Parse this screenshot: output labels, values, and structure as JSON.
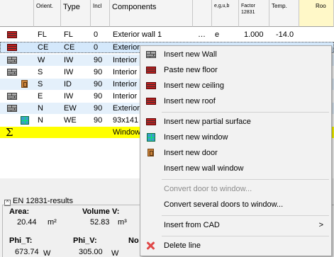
{
  "grid": {
    "headers": {
      "orient": "Orient.",
      "type": "Type",
      "incl": "Incl",
      "components": "Components",
      "egub": "e,g,u,b",
      "factor": "Factor\n12831",
      "temp": "Temp.",
      "room": "Roo"
    },
    "rows": [
      {
        "icon": "floor-icon",
        "orient": "FL",
        "type": "FL",
        "incl": "0",
        "component": "Exterior wall 1",
        "dots": "…",
        "egub": "e",
        "factor": "1.000",
        "temp": "-14.0"
      },
      {
        "icon": "floor-icon",
        "orient": "CE",
        "type": "CE",
        "incl": "0",
        "component": "Exterior"
      },
      {
        "icon": "wall-icon",
        "orient": "W",
        "type": "IW",
        "incl": "90",
        "component": "Interior"
      },
      {
        "icon": "wall-icon",
        "orient": "S",
        "type": "IW",
        "incl": "90",
        "component": "Interior"
      },
      {
        "icon": "door-icon",
        "orient": "S",
        "type": "ID",
        "incl": "90",
        "component": "Interior"
      },
      {
        "icon": "wall-icon",
        "orient": "E",
        "type": "IW",
        "incl": "90",
        "component": "Interior"
      },
      {
        "icon": "wall-icon",
        "orient": "N",
        "type": "EW",
        "incl": "90",
        "component": "Exterior"
      },
      {
        "icon": "window-icon",
        "orient": "N",
        "type": "WE",
        "incl": "90",
        "component": "93x141"
      }
    ],
    "sum_row": {
      "symbol": "Σ",
      "component": "Window"
    }
  },
  "results": {
    "title": "EN 12831-results",
    "collapse_glyph": "^",
    "area_label": "Area:",
    "area_value": "20.44",
    "area_unit": "m²",
    "volume_label": "Volume V:",
    "volume_value": "52.83",
    "volume_unit": "m³",
    "phi_t_label": "Phi_T:",
    "phi_t_value": "673.74",
    "phi_t_unit": "W",
    "phi_v_label": "Phi_V:",
    "phi_v_value": "305.00",
    "phi_v_unit": "W",
    "no_label": "No"
  },
  "menu": {
    "items": [
      {
        "label": "Insert new Wall",
        "icon": "wall-icon"
      },
      {
        "label": "Paste new floor",
        "icon": "floor-icon"
      },
      {
        "label": "Insert new ceiling",
        "icon": "ceiling-icon"
      },
      {
        "label": "Insert new roof",
        "icon": "roof-icon"
      },
      {
        "label": "Insert new partial surface",
        "icon": "partial-surface-icon"
      },
      {
        "label": "Insert new window",
        "icon": "window-icon"
      },
      {
        "label": "Insert new door",
        "icon": "door-icon"
      },
      {
        "label": "Insert new wall window"
      },
      {
        "label": "Convert door to window...",
        "disabled": true
      },
      {
        "label": "Convert several doors to window..."
      },
      {
        "label": "Insert from CAD",
        "submenu_arrow": ">"
      },
      {
        "label": "Delete line",
        "icon": "delete-icon"
      }
    ]
  }
}
